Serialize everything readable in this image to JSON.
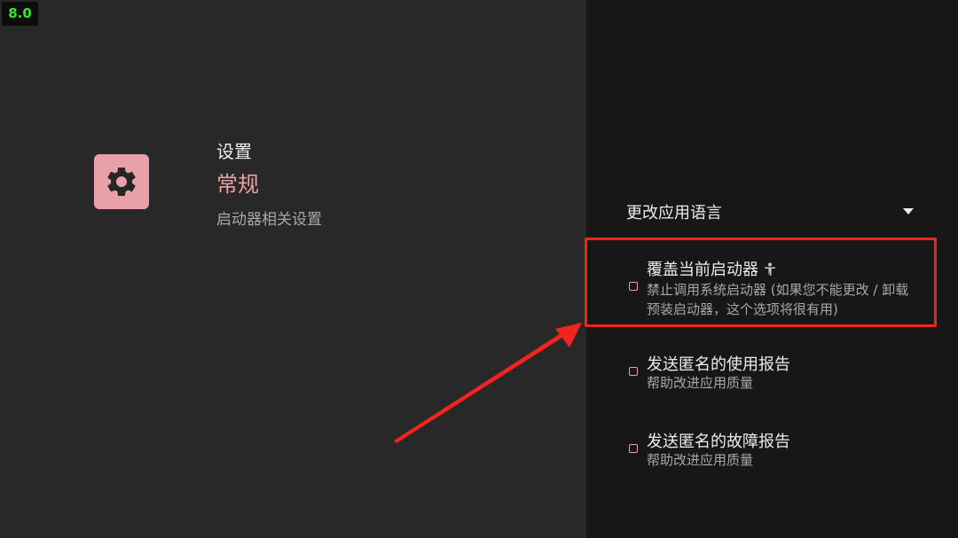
{
  "overlay": {
    "fps": "8.0"
  },
  "header": {
    "settings_label": "设置",
    "category_title": "常规",
    "category_description": "启动器相关设置",
    "icon": "gear-icon"
  },
  "language": {
    "label": "更改应用语言",
    "icon": "triangle-down-icon"
  },
  "options": [
    {
      "title": "覆盖当前启动器",
      "description": "禁止调用系统启动器 (如果您不能更改 / 卸载预装启动器，这个选项将很有用)",
      "checked": false,
      "icon": "accessibility-icon"
    },
    {
      "title": "发送匿名的使用报告",
      "description": "帮助改进应用质量",
      "checked": false
    },
    {
      "title": "发送匿名的故障报告",
      "description": "帮助改进应用质量",
      "checked": false
    }
  ],
  "colors": {
    "accent": "#e8a1a6",
    "highlight": "#f3231d",
    "fps": "#39e62e"
  }
}
